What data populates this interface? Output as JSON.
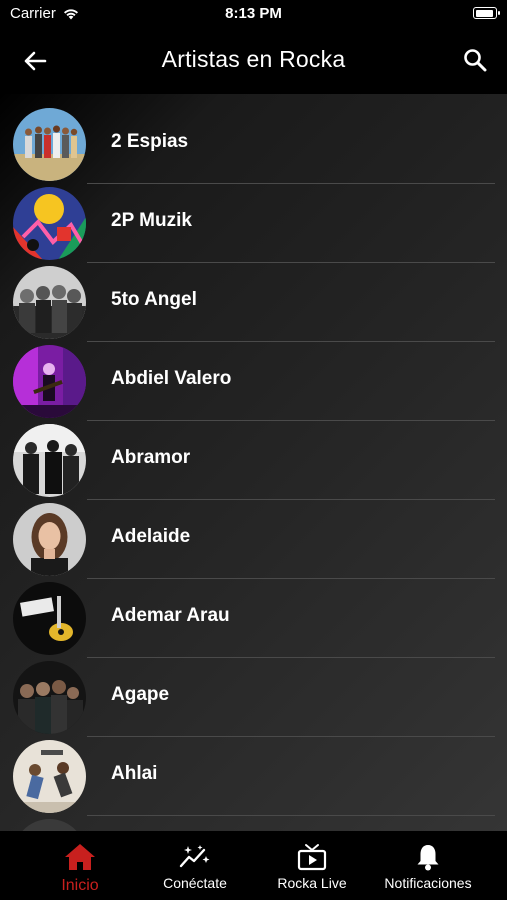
{
  "status_bar": {
    "carrier": "Carrier",
    "time": "8:13 PM"
  },
  "nav": {
    "title": "Artistas en Rocka"
  },
  "artists": [
    {
      "name": "2 Espias"
    },
    {
      "name": "2P Muzik"
    },
    {
      "name": "5to Angel"
    },
    {
      "name": "Abdiel Valero"
    },
    {
      "name": "Abramor"
    },
    {
      "name": "Adelaide"
    },
    {
      "name": "Ademar Arau"
    },
    {
      "name": "Agape"
    },
    {
      "name": "Ahlai"
    }
  ],
  "tabs": [
    {
      "label": "Inicio",
      "icon": "home-icon",
      "active": true
    },
    {
      "label": "Conéctate",
      "icon": "sparkle-chart-icon",
      "active": false
    },
    {
      "label": "Rocka Live",
      "icon": "tv-play-icon",
      "active": false
    },
    {
      "label": "Notificaciones",
      "icon": "bell-icon",
      "active": false
    }
  ],
  "colors": {
    "accent": "#c8201e",
    "background": "#000000",
    "text": "#ffffff",
    "divider": "#4a4a4a"
  }
}
